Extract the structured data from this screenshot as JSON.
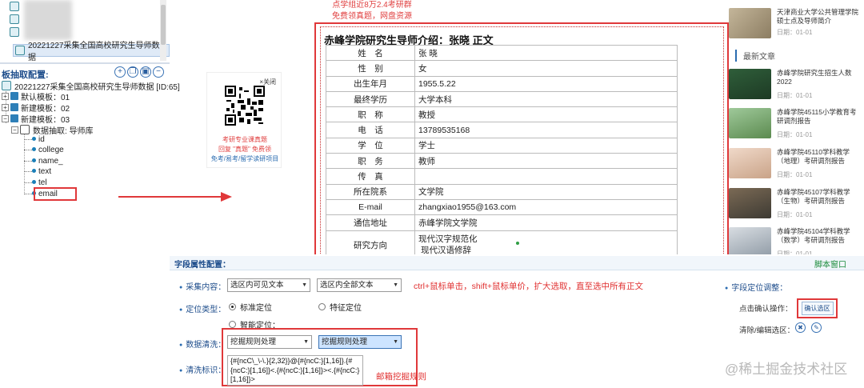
{
  "top_tree": {
    "selected_item": "20221227采集全国高校研究生导师数据"
  },
  "panel": {
    "title": "板抽取配置:",
    "toolbar_icons": [
      "add-icon",
      "copy-icon",
      "save-icon",
      "remove-icon"
    ]
  },
  "tree": {
    "root": "20221227采集全国高校研究生导师数据 [ID:65]",
    "templates": [
      "默认模板：01",
      "新建模板：02",
      "新建模板：03"
    ],
    "extract_node": "数据抽取: 导师库",
    "fields": [
      "id",
      "college",
      "name_",
      "text",
      "tel",
      "email"
    ]
  },
  "qr": {
    "close": "×关闭",
    "line1": "考研专业课真题",
    "line2": "回复 \"真题\" 免费领",
    "line3": "免考/易考/留学读研项目"
  },
  "center": {
    "header_line1": "点学组近8万2.4考研群",
    "header_line2": "免费领真题，网盘资源",
    "page_title": "赤峰学院研究生导师介绍：张晓 正文",
    "rows": [
      {
        "k": "姓　名",
        "v": "张 晓"
      },
      {
        "k": "性　别",
        "v": "女"
      },
      {
        "k": "出生年月",
        "v": "1955.5.22"
      },
      {
        "k": "最终学历",
        "v": "大学本科"
      },
      {
        "k": "职　称",
        "v": "教授"
      },
      {
        "k": "电　话",
        "v": "13789535168"
      },
      {
        "k": "学　位",
        "v": "学士"
      },
      {
        "k": "职　务",
        "v": "教师"
      },
      {
        "k": "传　真",
        "v": ""
      },
      {
        "k": "所在院系",
        "v": "文学院"
      },
      {
        "k": "E-mail",
        "v": "zhangxiao1955@163.com"
      },
      {
        "k": "通信地址",
        "v": "赤峰学院文学院"
      },
      {
        "k": "研究方向",
        "v": "现代汉字规范化"
      }
    ],
    "research_line2": "现代汉语修辞"
  },
  "right": {
    "articles": [
      {
        "title": "天津商业大学公共管理学院硕士点及导师简介",
        "date": "日期：01-01"
      },
      {
        "title": "赤峰学院研究生招生人数2022",
        "date": "日期：01-01"
      },
      {
        "title": "赤峰学院45115小学教育考研调剂报告",
        "date": "日期：01-01"
      },
      {
        "title": "赤峰学院45110学科教学（地理）考研调剂报告",
        "date": "日期：01-01"
      },
      {
        "title": "赤峰学院45107学科教学（生物）考研调剂报告",
        "date": "日期：01-01"
      },
      {
        "title": "赤峰学院45104学科教学（数学）考研调剂报告",
        "date": "日期：01-01"
      }
    ],
    "latest_header": "最新文章"
  },
  "config": {
    "title": "字段属性配置：",
    "script_window": "脚本窗口",
    "collect_label": "采集内容：",
    "collect_opt1": "选区内可见文本",
    "collect_opt2": "选区内全部文本",
    "locate_label": "定位类型：",
    "locate_standard": "标准定位",
    "locate_feature": "特征定位",
    "locate_smart": "智能定位：",
    "clean_label": "数据清洗：",
    "clean_opt1": "挖掘规则处理",
    "clean_opt2": "挖掘规则处理",
    "mark_label": "清洗标识：",
    "mark_text": "{#{ncC\\_\\-\\.}{2,32}}@{#{ncC:}[1,16]}.{#{ncC:}[1,16]}<.{#{ncC:}[1,16]}><.{#{ncC:}[1,16]}>",
    "instruction": "ctrl+鼠标单击，shift+鼠标单价，扩大选取，直至选中所有正文",
    "email_rule": "邮箱挖掘规则",
    "field_locate": "字段定位调整：",
    "click_confirm": "点击确认操作：",
    "confirm_button": "确认选区",
    "clear_edit": "清除/编辑选区："
  },
  "watermark": "@稀土掘金技术社区",
  "colors": {
    "annotation_red": "#e0383a",
    "accent_blue": "#1f4e8c",
    "script_green": "#1a8b3a"
  }
}
